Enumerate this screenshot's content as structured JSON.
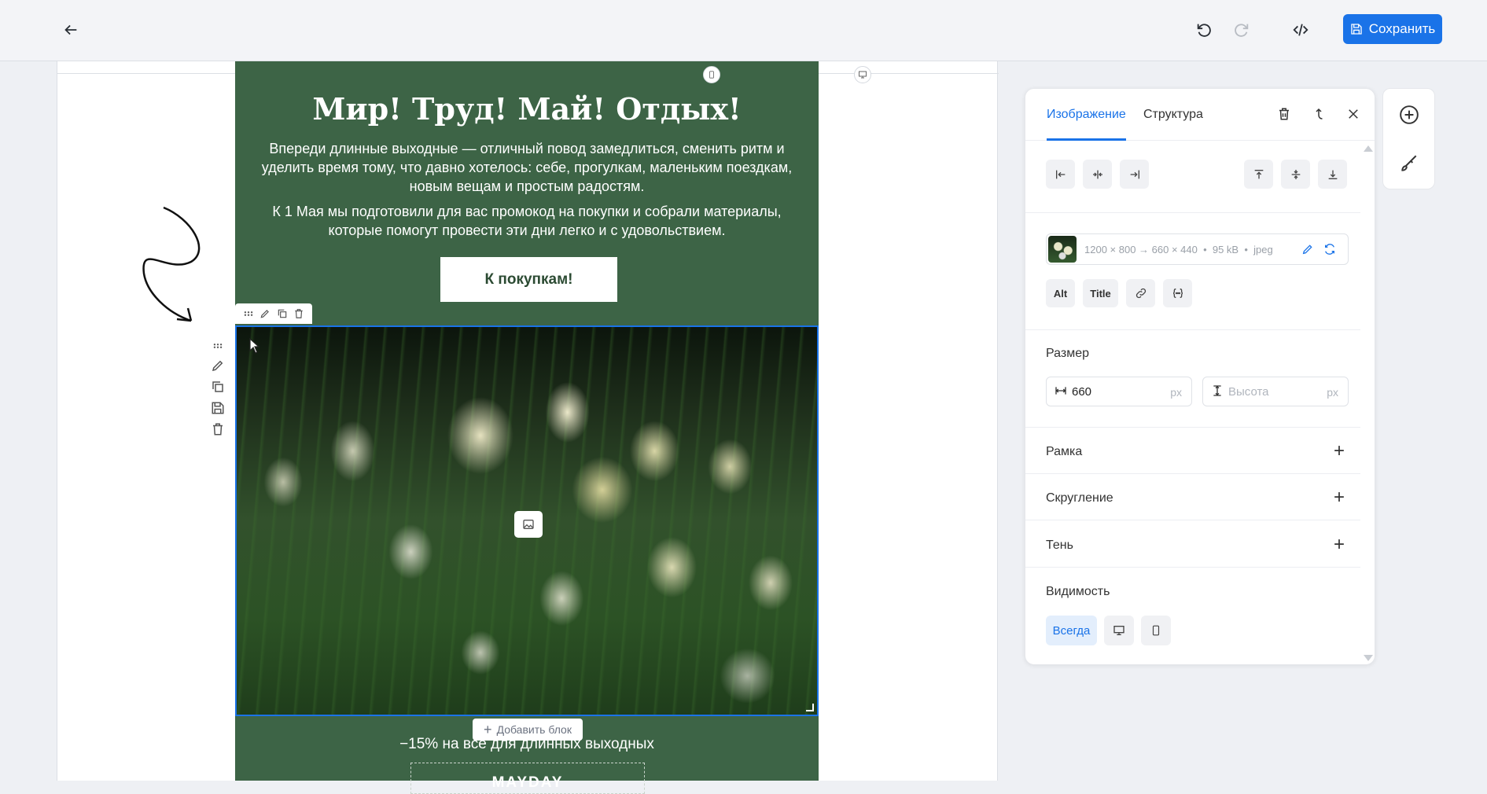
{
  "topbar": {
    "save_label": "Сохранить"
  },
  "email": {
    "title": "Мир! Труд! Май! Отдых!",
    "paragraph1": "Впереди длинные выходные — отличный повод замедлиться, сменить ритм и уделить время тому, что давно хотелось: себе, прогулкам, маленьким поездкам, новым вещам и простым радостям.",
    "paragraph2": "К 1 Мая мы подготовили для вас промокод на покупки и собрали материалы, которые помогут провести эти дни легко и с удовольствием.",
    "cta_label": "К покупкам!",
    "add_block_label": "Добавить блок",
    "promo_text": "−15% на все для длинных выходных",
    "promo_code": "MAYDAY"
  },
  "panel": {
    "tabs": [
      {
        "label": "Изображение",
        "active": true
      },
      {
        "label": "Структура",
        "active": false
      }
    ],
    "file": {
      "dimensions": "1200 × 800 → 660 × 440",
      "size": "95 kB",
      "format": "jpeg"
    },
    "attr_buttons": {
      "alt": "Alt",
      "title": "Title"
    },
    "size": {
      "label": "Размер",
      "width_value": "660",
      "height_placeholder": "Высота",
      "unit": "px"
    },
    "sections": {
      "border": "Рамка",
      "radius": "Скругление",
      "shadow": "Тень"
    },
    "visibility": {
      "label": "Видимость",
      "always": "Всегда"
    }
  },
  "colors": {
    "accent": "#1a73e8",
    "email_bg": "#3d6446"
  }
}
